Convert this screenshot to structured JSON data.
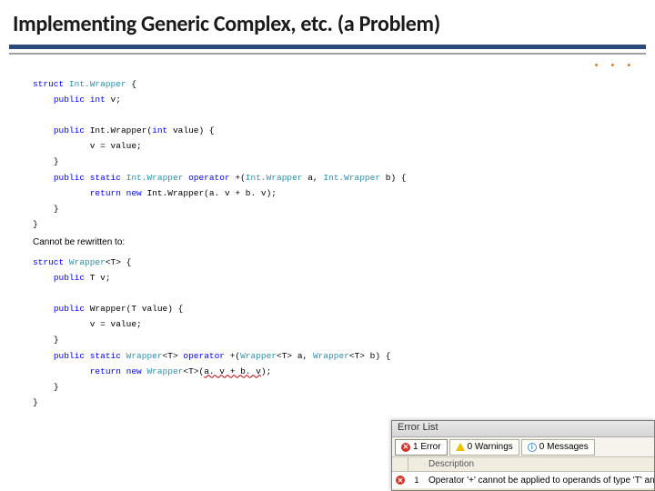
{
  "title": "Implementing Generic Complex, etc. (a Problem)",
  "accent_dots": ". . .",
  "code1": {
    "l01_kw1": "struct",
    "l01_typ": "Int.Wrapper",
    "l01_txt": " {",
    "l02_kw1": "public",
    "l02_kw2": "int",
    "l02_txt": " v;",
    "l04_kw1": "public",
    "l04_txt1": " Int.Wrapper(",
    "l04_kw2": "int",
    "l04_txt2": " value) {",
    "l05_txt": "v = value;",
    "l06_txt": "}",
    "l07_kw1": "public",
    "l07_kw2": "static",
    "l07_typ1": "Int.Wrapper",
    "l07_kw3": "operator",
    "l07_txt1": " +(",
    "l07_typ2": "Int.Wrapper",
    "l07_txt2": " a, ",
    "l07_typ3": "Int.Wrapper",
    "l07_txt3": " b) {",
    "l08_kw1": "return",
    "l08_kw2": "new",
    "l08_txt1": " Int.Wrapper(a. v + b. v);",
    "l09_txt": "}",
    "l10_txt": "}"
  },
  "caption": "Cannot be rewritten to:",
  "code2": {
    "l01_kw1": "struct",
    "l01_typ": "Wrapper",
    "l01_txt1": "<T> {",
    "l02_kw1": "public",
    "l02_txt": " T v;",
    "l04_kw1": "public",
    "l04_txt": " Wrapper(T value) {",
    "l05_txt": "v = value;",
    "l06_txt": "}",
    "l07_kw1": "public",
    "l07_kw2": "static",
    "l07_typ1": "Wrapper",
    "l07_txt1": "<T> ",
    "l07_kw3": "operator",
    "l07_txt2": " +(",
    "l07_typ2": "Wrapper",
    "l07_txt3": "<T> a, ",
    "l07_typ3": "Wrapper",
    "l07_txt4": "<T> b) {",
    "l08_kw1": "return",
    "l08_kw2": "new",
    "l08_typ": "Wrapper",
    "l08_txt1": "<T>(",
    "l08_sq": "a. v + b. v",
    "l08_txt2": ");",
    "l09_txt": "}",
    "l10_txt": "}"
  },
  "error_panel": {
    "title": "Error List",
    "filters": {
      "errors": "1 Error",
      "warnings": "0 Warnings",
      "messages": "0 Messages"
    },
    "columns": {
      "description": "Description"
    },
    "rows": [
      {
        "num": "1",
        "desc": "Operator '+' cannot be applied to operands of type 'T' and 'T'"
      }
    ]
  }
}
